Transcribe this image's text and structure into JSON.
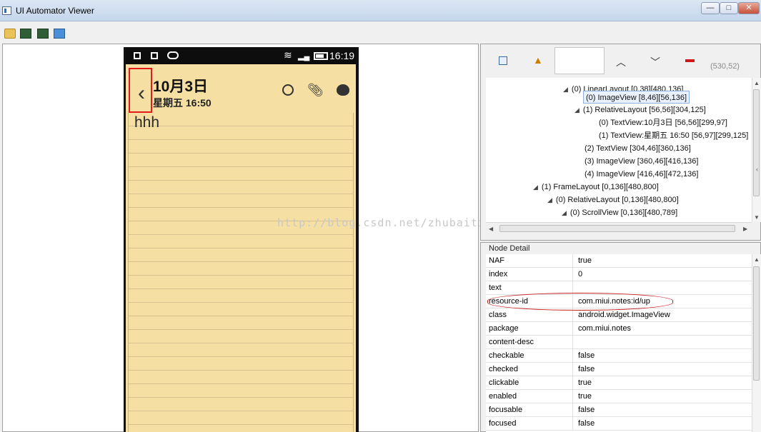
{
  "window": {
    "title": "UI Automator Viewer",
    "min_label": "—",
    "max_label": "□",
    "close_label": "✕"
  },
  "phone": {
    "status_time": "16:19",
    "note_date": "10月3日",
    "note_weekday": "星期五 16:50",
    "back_glyph": "‹",
    "note_text": "hhh"
  },
  "watermark": "http://blog.csdn.net/zhubaitian",
  "hierarchy": {
    "toolbar": {
      "expand_icon": "expand-all-icon",
      "warning_icon": "warning-icon",
      "prev_glyph": "︿",
      "next_glyph": "﹀",
      "counter": "(530,52)"
    },
    "tree": [
      "(0) LinearLayout [0,38][480,136]",
      "(0) ImageView [8,46][56,136]",
      "(1) RelativeLayout [56,56][304,125]",
      "(0) TextView:10月3日 [56,56][299,97]",
      "(1) TextView:星期五 16:50 [56,97][299,125]",
      "(2) TextView [304,46][360,136]",
      "(3) ImageView [360,46][416,136]",
      "(4) ImageView [416,46][472,136]",
      "(1) FrameLayout [0,136][480,800]",
      "(0) RelativeLayout [0,136][480,800]",
      "(0) ScrollView [0,136][480,789]"
    ]
  },
  "node_detail": {
    "title": "Node Detail",
    "rows": [
      {
        "key": "NAF",
        "value": "true"
      },
      {
        "key": "index",
        "value": "0"
      },
      {
        "key": "text",
        "value": ""
      },
      {
        "key": "resource-id",
        "value": "com.miui.notes:id/up"
      },
      {
        "key": "class",
        "value": "android.widget.ImageView"
      },
      {
        "key": "package",
        "value": "com.miui.notes"
      },
      {
        "key": "content-desc",
        "value": ""
      },
      {
        "key": "checkable",
        "value": "false"
      },
      {
        "key": "checked",
        "value": "false"
      },
      {
        "key": "clickable",
        "value": "true"
      },
      {
        "key": "enabled",
        "value": "true"
      },
      {
        "key": "focusable",
        "value": "false"
      },
      {
        "key": "focused",
        "value": "false"
      }
    ]
  },
  "colors": {
    "note_bg": "#f6dfa2",
    "highlight_red": "#e21b1b",
    "selection_blue": "#e9f1fc"
  }
}
